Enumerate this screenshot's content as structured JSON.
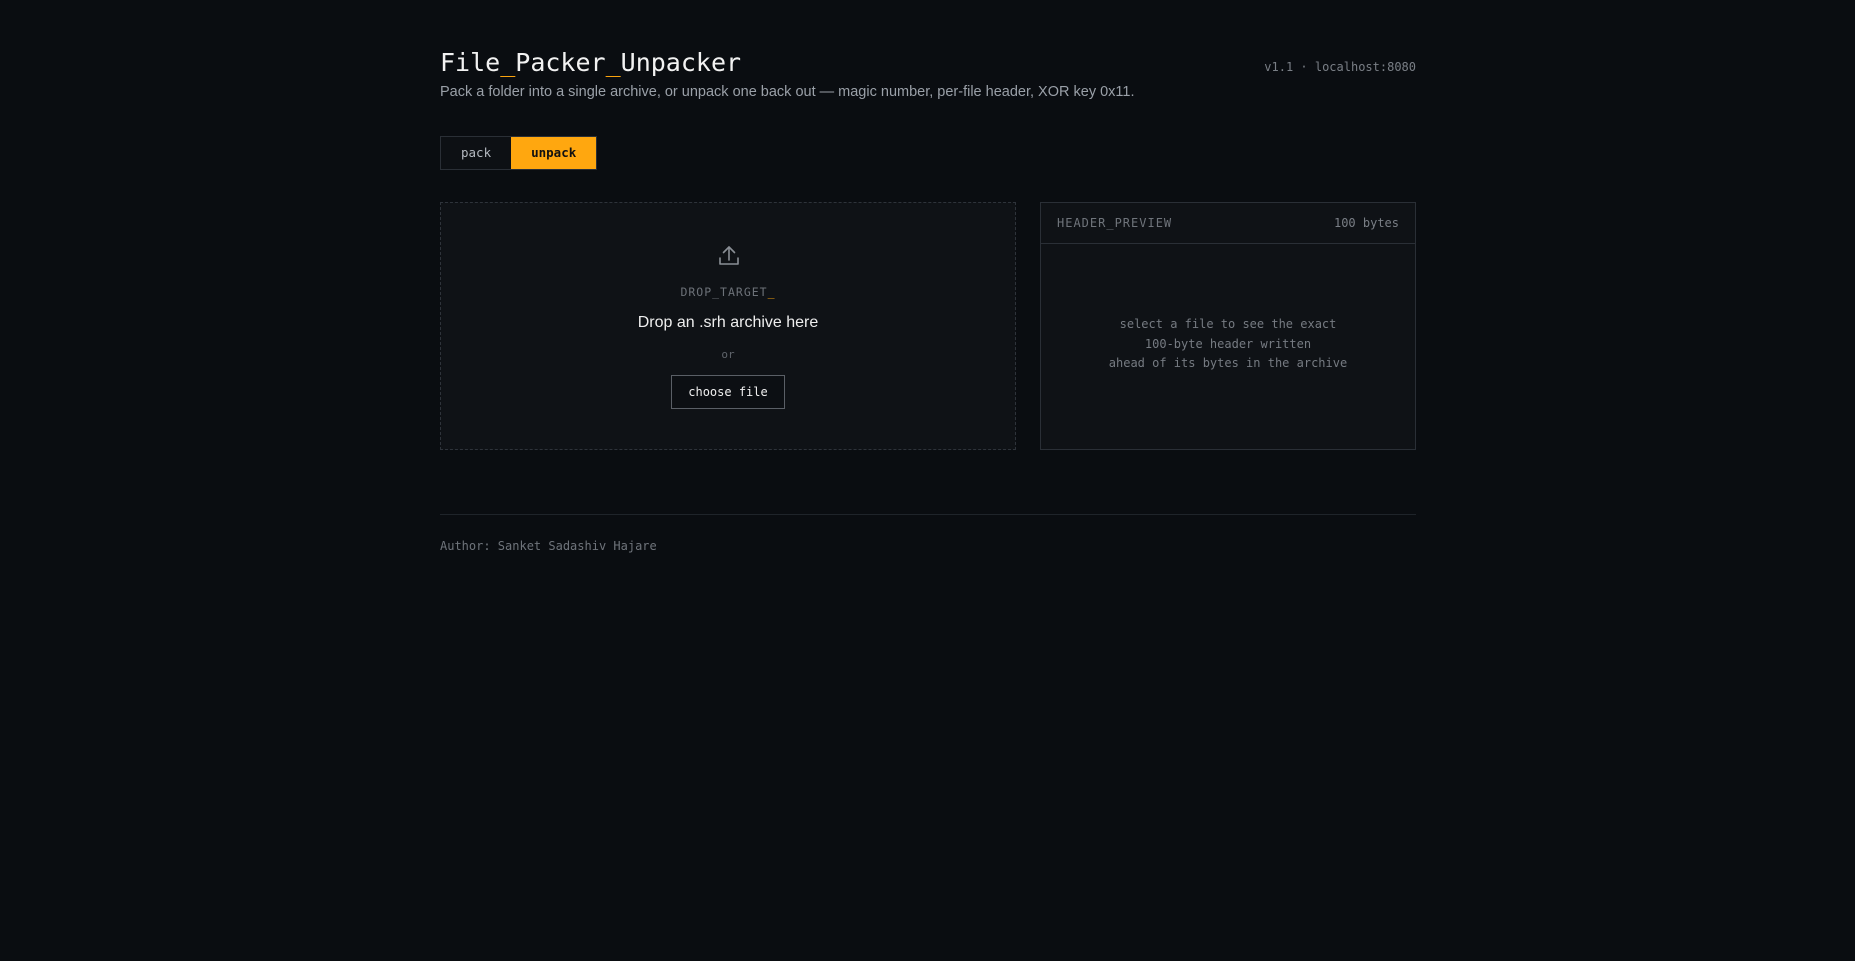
{
  "header": {
    "title_parts": [
      "File",
      "_",
      "Packer",
      "_",
      "Unpacker"
    ],
    "version": "v1.1 · localhost:8080",
    "subtitle": "Pack a folder into a single archive, or unpack one back out — magic number, per-file header, XOR key 0x11."
  },
  "tabs": [
    {
      "label": "pack",
      "active": false
    },
    {
      "label": "unpack",
      "active": true
    }
  ],
  "drop_zone": {
    "icon": "upload-icon",
    "label": "DROP_TARGET",
    "cursor": "_",
    "main_text": "Drop an .srh archive here",
    "or_text": "or",
    "button_label": "choose file"
  },
  "preview": {
    "title": "HEADER_PREVIEW",
    "size": "100 bytes",
    "lines": [
      "select a file to see the exact",
      "100-byte header written",
      "ahead of its bytes in the archive"
    ]
  },
  "footer": {
    "author": "Author: Sanket Sadashiv Hajare"
  },
  "colors": {
    "background": "#0a0d11",
    "accent": "#ffa70f",
    "panel": "#0f1216",
    "border": "#2a2f36"
  }
}
